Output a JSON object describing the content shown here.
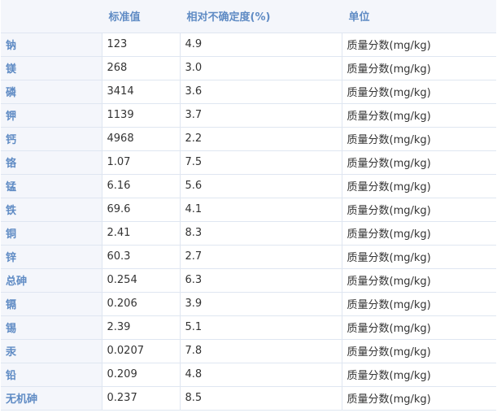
{
  "header": {
    "col_element": "",
    "col_standard": "标准值",
    "col_uncertainty": "相对不确定度(%)",
    "col_unit": "单位"
  },
  "rows": [
    {
      "element": "钠",
      "value": "123",
      "uncertainty": "4.9",
      "unit": "质量分数(mg/kg)"
    },
    {
      "element": "镁",
      "value": "268",
      "uncertainty": "3.0",
      "unit": "质量分数(mg/kg)"
    },
    {
      "element": "磷",
      "value": "3414",
      "uncertainty": "3.6",
      "unit": "质量分数(mg/kg)"
    },
    {
      "element": "钾",
      "value": "1139",
      "uncertainty": "3.7",
      "unit": "质量分数(mg/kg)"
    },
    {
      "element": "钙",
      "value": "4968",
      "uncertainty": "2.2",
      "unit": "质量分数(mg/kg)"
    },
    {
      "element": "铬",
      "value": "1.07",
      "uncertainty": "7.5",
      "unit": "质量分数(mg/kg)"
    },
    {
      "element": "锰",
      "value": "6.16",
      "uncertainty": "5.6",
      "unit": "质量分数(mg/kg)"
    },
    {
      "element": "铁",
      "value": "69.6",
      "uncertainty": "4.1",
      "unit": "质量分数(mg/kg)"
    },
    {
      "element": "铜",
      "value": "2.41",
      "uncertainty": "8.3",
      "unit": "质量分数(mg/kg)"
    },
    {
      "element": "锌",
      "value": "60.3",
      "uncertainty": "2.7",
      "unit": "质量分数(mg/kg)"
    },
    {
      "element": "总砷",
      "value": "0.254",
      "uncertainty": "6.3",
      "unit": "质量分数(mg/kg)"
    },
    {
      "element": "镉",
      "value": "0.206",
      "uncertainty": "3.9",
      "unit": "质量分数(mg/kg)"
    },
    {
      "element": "锡",
      "value": "2.39",
      "uncertainty": "5.1",
      "unit": "质量分数(mg/kg)"
    },
    {
      "element": "汞",
      "value": "0.0207",
      "uncertainty": "7.8",
      "unit": "质量分数(mg/kg)"
    },
    {
      "element": "铅",
      "value": "0.209",
      "uncertainty": "4.8",
      "unit": "质量分数(mg/kg)"
    },
    {
      "element": "无机砷",
      "value": "0.237",
      "uncertainty": "8.5",
      "unit": "质量分数(mg/kg)"
    }
  ]
}
